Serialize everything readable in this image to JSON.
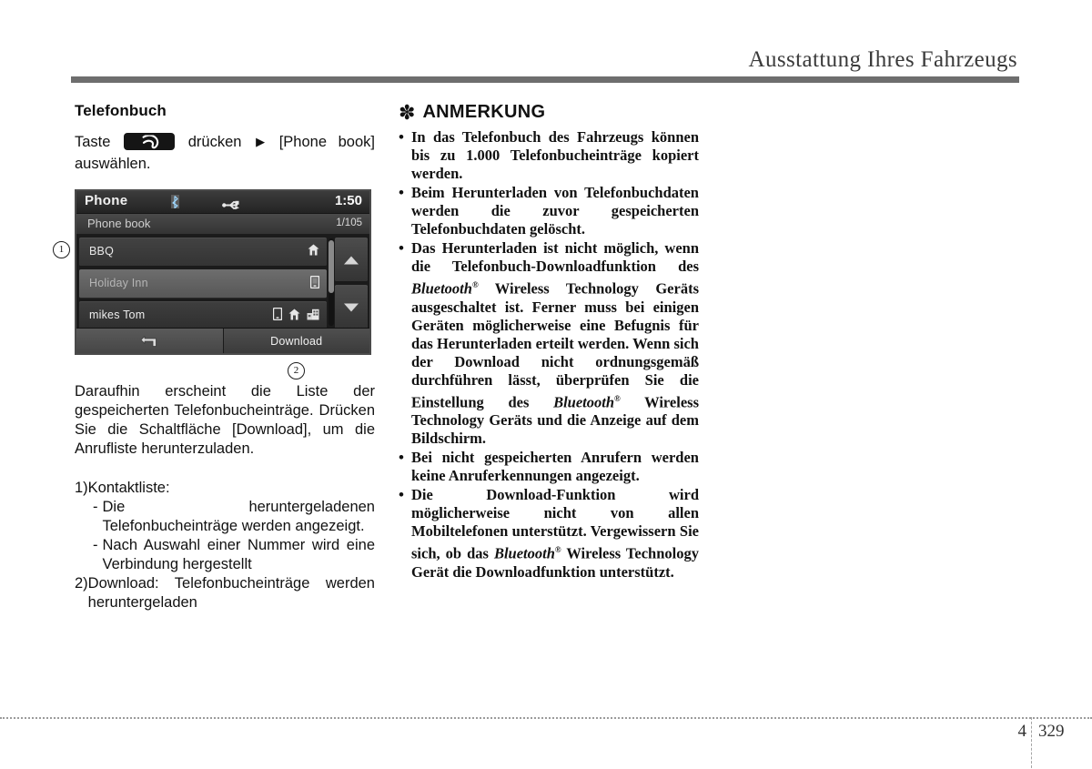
{
  "header": {
    "title": "Ausstattung Ihres Fahrzeugs"
  },
  "left": {
    "section_title": "Telefonbuch",
    "press_line_prefix": "Taste",
    "press_key_icon": "phone-handset-icon",
    "press_line_mid": "drücken",
    "press_line_arrow": "▶",
    "press_line_suffix": "[Phone book] auswählen.",
    "paragraph": "Daraufhin erscheint die Liste der gespeicherten Telefonbucheinträge. Drücken Sie die Schaltfläche [Download], um die Anrufliste herunterzuladen.",
    "numbered": [
      {
        "marker": "1)",
        "text": "Kontaktliste:",
        "sub": [
          {
            "marker": "-",
            "text": "Die heruntergeladenen Telefonbucheinträge werden angezeigt."
          },
          {
            "marker": "-",
            "text": "Nach Auswahl einer Nummer wird eine Verbindung hergestellt"
          }
        ]
      },
      {
        "marker": "2)",
        "text": "Download: Telefonbucheinträge werden heruntergeladen",
        "sub": []
      }
    ],
    "callouts": {
      "one": "①",
      "two": "②"
    }
  },
  "device": {
    "title": "Phone",
    "clock": "1:50",
    "status_icons": [
      "bluetooth-icon",
      "usb-icon"
    ],
    "subtitle": "Phone book",
    "counter": "1/105",
    "rows": [
      {
        "label": "BBQ",
        "icons": [
          "home-phone-icon"
        ],
        "state": "selected"
      },
      {
        "label": "Holiday Inn",
        "icons": [
          "mobile-phone-icon"
        ],
        "state": "highlighted"
      },
      {
        "label": "mikes Tom",
        "icons": [
          "mobile-phone-icon",
          "home-phone-icon",
          "office-phone-icon"
        ],
        "state": "normal"
      }
    ],
    "scroll_up_icon": "triangle-up-icon",
    "scroll_down_icon": "triangle-down-icon",
    "back_icon": "back-arrow-icon",
    "download_label": "Download"
  },
  "note": {
    "asterisk": "✽",
    "title": "ANMERKUNG",
    "bullet": "•",
    "items": [
      "In das Telefonbuch des Fahrzeugs können bis zu 1.000 Telefonbucheinträge kopiert werden.",
      "Beim Herunterladen von Telefonbuchdaten werden die zuvor gespeicherten Telefonbuchdaten gelöscht.",
      "Das Herunterladen ist nicht möglich, wenn die Telefonbuch-Downloadfunktion des ||Bluetooth||(R)|| Wireless Technology Geräts ausgeschaltet ist. Ferner muss bei einigen Geräten möglicherweise eine Befugnis für das Herunterladen erteilt werden. Wenn sich der Download nicht ordnungsgemäß durchführen lässt, überprüfen Sie die Einstellung des ||Bluetooth||(R)|| Wireless Technology Geräts und die Anzeige auf dem Bildschirm.",
      "Bei nicht gespeicherten Anrufern werden keine Anruferkennungen angezeigt.",
      "Die Download-Funktion wird möglicherweise nicht von allen Mobiltelefonen unterstützt. Vergewissern Sie sich, ob das ||Bluetooth||(R)|| Wireless Technology Gerät die Downloadfunktion unterstützt."
    ]
  },
  "footer": {
    "chapter": "4",
    "page": "329"
  }
}
